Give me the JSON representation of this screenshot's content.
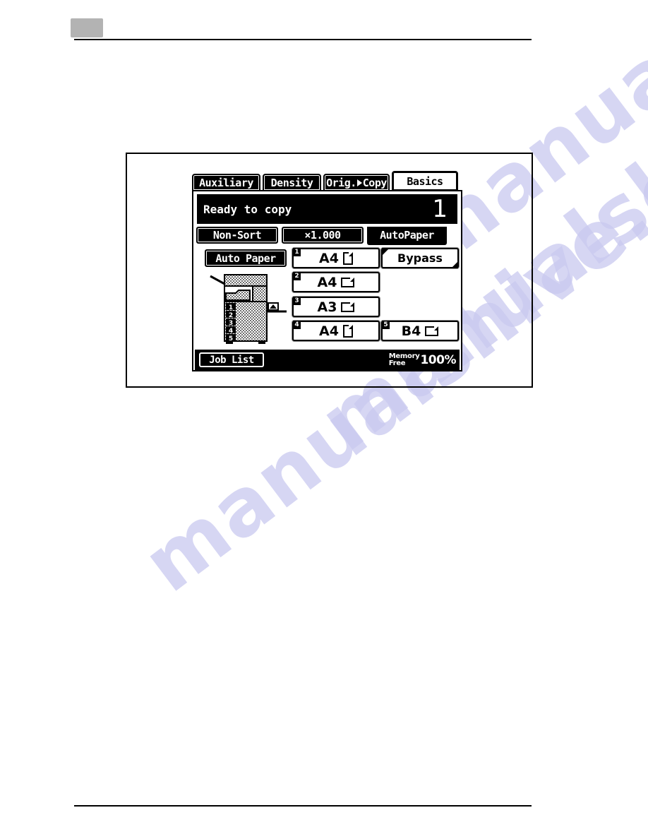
{
  "page": {
    "watermark_text": "manualshive.com",
    "header_marker": "",
    "rules": {
      "top": "",
      "bottom": ""
    }
  },
  "figure": {
    "caption": ""
  },
  "lcd": {
    "tabs": [
      {
        "label": "Auxiliary",
        "name": "tab-auxiliary",
        "active": false
      },
      {
        "label": "Density",
        "name": "tab-density",
        "active": false
      },
      {
        "label": "Orig.",
        "label_suffix": "Copy",
        "name": "tab-orig-copy",
        "active": false
      },
      {
        "label": "Basics",
        "name": "tab-basics",
        "active": true
      }
    ],
    "status": {
      "message": "Ready to copy",
      "copy_count": "1"
    },
    "subtabs": [
      {
        "label": "Non-Sort",
        "active": false
      },
      {
        "label": "×1.000",
        "active": false
      },
      {
        "label": "AutoPaper",
        "active": true
      }
    ],
    "auto_paper_button": {
      "label": "Auto Paper",
      "selected": true
    },
    "trays": [
      {
        "number": "1",
        "size": "A4",
        "orientation": "portrait"
      },
      {
        "number": "2",
        "size": "A4",
        "orientation": "landscape"
      },
      {
        "number": "3",
        "size": "A3",
        "orientation": "landscape"
      },
      {
        "number": "4",
        "size": "A4",
        "orientation": "portrait"
      },
      {
        "number": "5",
        "size": "B4",
        "orientation": "landscape"
      }
    ],
    "bypass": {
      "label": "Bypass"
    },
    "printer_graphic": {
      "tray_numbers": [
        "1",
        "2",
        "3",
        "4",
        "5"
      ]
    },
    "footer": {
      "job_list_label": "Job List",
      "memory_label_line1": "Memory",
      "memory_label_line2": "Free",
      "memory_value": "100%"
    }
  },
  "colors": {
    "lcd_background": "#ffffff",
    "lcd_foreground": "#000000",
    "page_background": "#ffffff",
    "header_block": "#b3b3b3",
    "watermark": "#c9c9ef"
  }
}
